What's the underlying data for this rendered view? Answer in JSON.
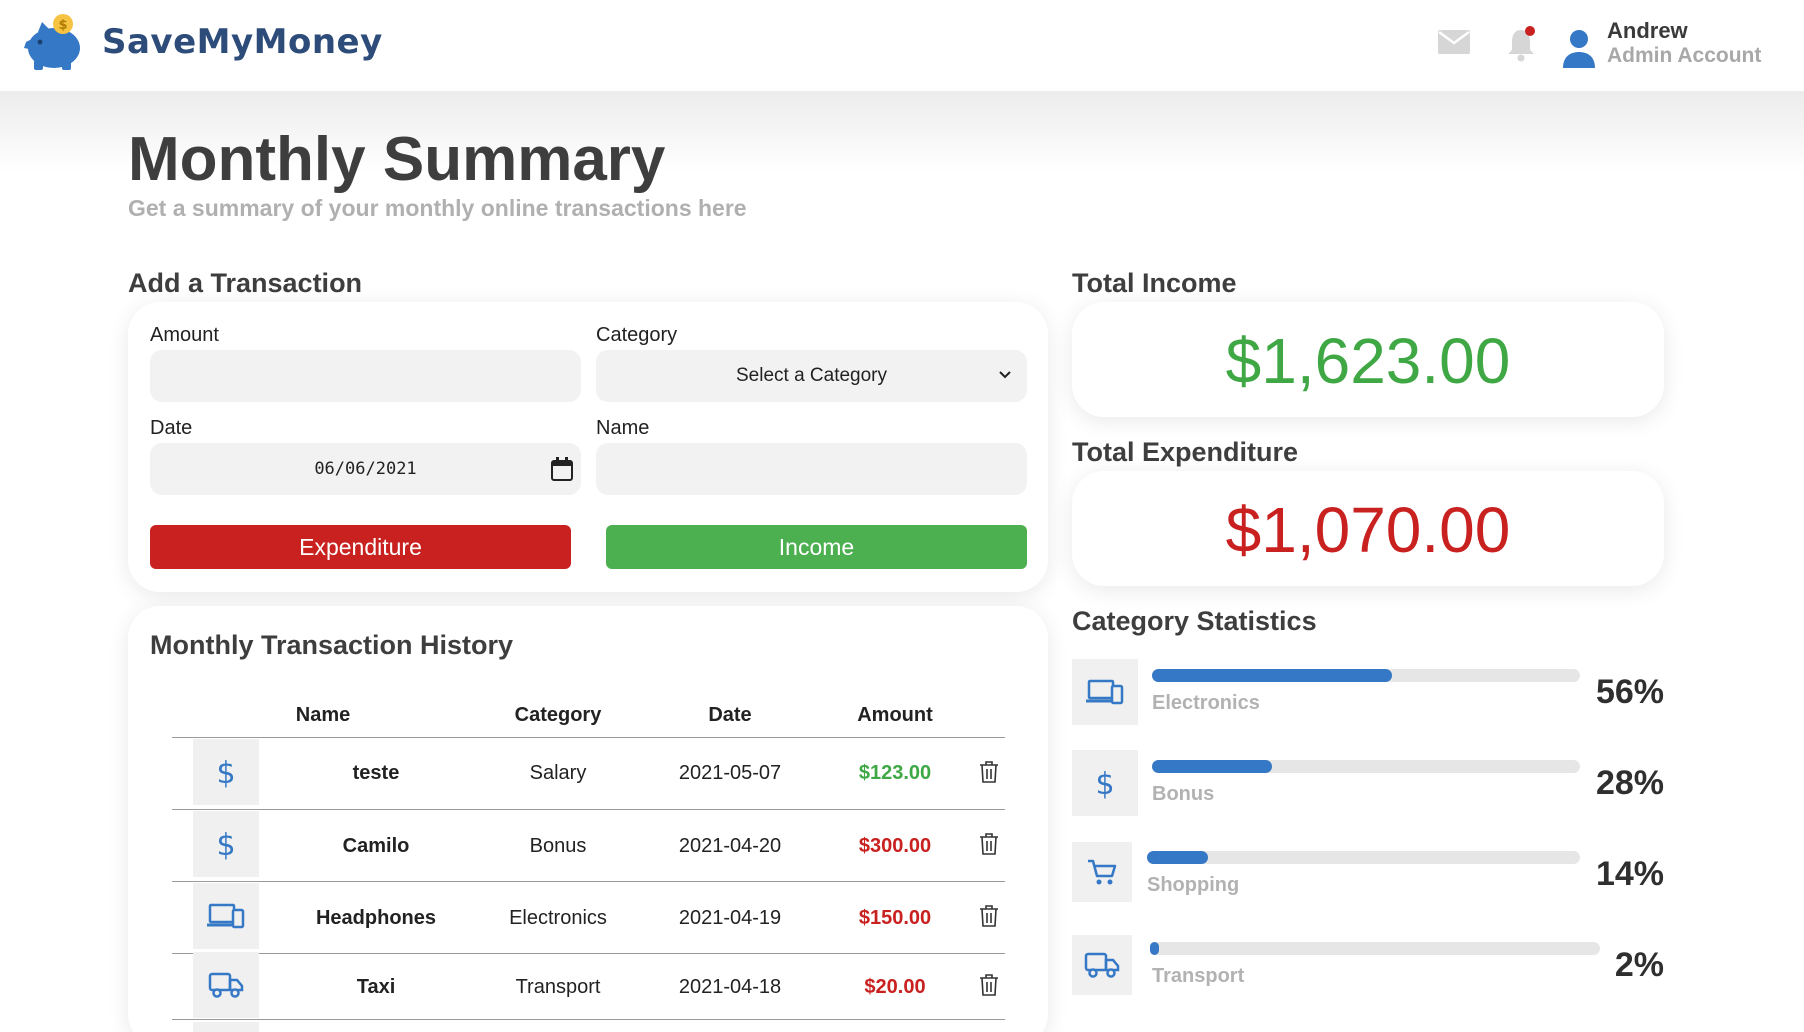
{
  "app": {
    "brand_name": "SaveMyMoney",
    "user": {
      "name": "Andrew",
      "role": "Admin Account"
    }
  },
  "page": {
    "title": "Monthly Summary",
    "subtitle": "Get a summary of your monthly online transactions here"
  },
  "add_transaction": {
    "title": "Add a Transaction",
    "amount_label": "Amount",
    "amount_value": "",
    "category_label": "Category",
    "category_selected": "Select a Category",
    "date_label": "Date",
    "date_value": "06/06/2021",
    "name_label": "Name",
    "name_value": "",
    "expenditure_button": "Expenditure",
    "income_button": "Income"
  },
  "totals": {
    "income_title": "Total Income",
    "income_value": "$1,623.00",
    "expenditure_title": "Total Expenditure",
    "expenditure_value": "$1,070.00"
  },
  "history": {
    "title": "Monthly Transaction History",
    "columns": [
      "Name",
      "Category",
      "Date",
      "Amount"
    ],
    "rows": [
      {
        "icon": "dollar-icon",
        "name": "teste",
        "category": "Salary",
        "date": "2021-05-07",
        "amount": "$123.00",
        "type": "income"
      },
      {
        "icon": "dollar-icon",
        "name": "Camilo",
        "category": "Bonus",
        "date": "2021-04-20",
        "amount": "$300.00",
        "type": "expenditure"
      },
      {
        "icon": "devices-icon",
        "name": "Headphones",
        "category": "Electronics",
        "date": "2021-04-19",
        "amount": "$150.00",
        "type": "expenditure"
      },
      {
        "icon": "truck-icon",
        "name": "Taxi",
        "category": "Transport",
        "date": "2021-04-18",
        "amount": "$20.00",
        "type": "expenditure"
      }
    ]
  },
  "stats": {
    "title": "Category Statistics",
    "items": [
      {
        "icon": "devices-icon",
        "label": "Electronics",
        "percent_label": "56%",
        "fill_fraction": 0.56
      },
      {
        "icon": "dollar-icon",
        "label": "Bonus",
        "percent_label": "28%",
        "fill_fraction": 0.28
      },
      {
        "icon": "cart-icon",
        "label": "Shopping",
        "percent_label": "14%",
        "fill_fraction": 0.14
      },
      {
        "icon": "truck-icon",
        "label": "Transport",
        "percent_label": "2%",
        "fill_fraction": 0.02
      }
    ]
  },
  "colors": {
    "brand": "#3578c6",
    "income": "#3fa845",
    "expenditure": "#c8211f",
    "bar_fill": "#3578c6"
  }
}
